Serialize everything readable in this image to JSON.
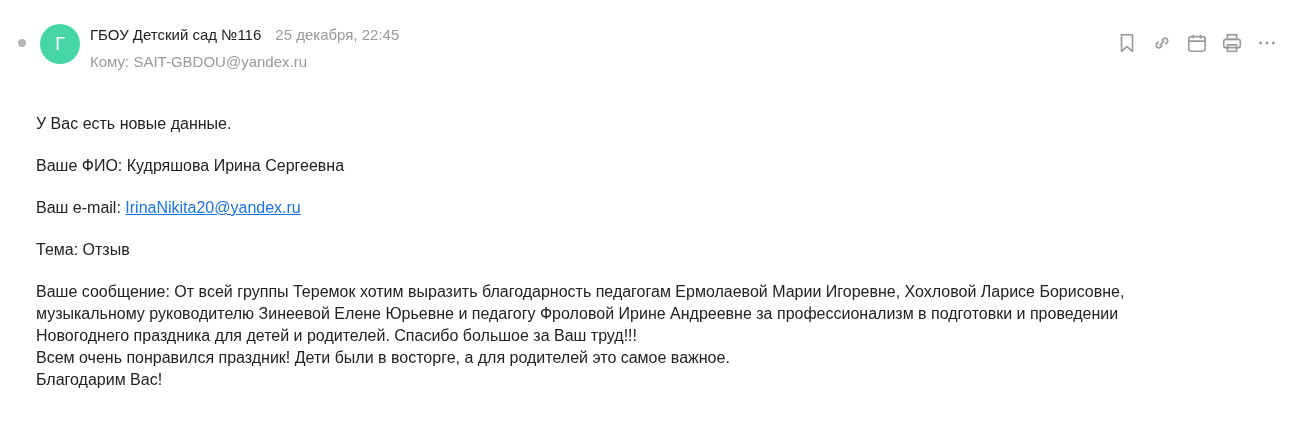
{
  "header": {
    "avatar_letter": "Г",
    "sender": "ГБОУ Детский сад №116",
    "date": "25 декабря, 22:45",
    "to": "Кому: SAIT-GBDOU@yandex.ru"
  },
  "body": [
    {
      "kind": "text",
      "text": "У Вас есть новые данные."
    },
    {
      "kind": "text",
      "text": "Ваше ФИО: Кудряшова Ирина Сергеевна"
    },
    {
      "kind": "link",
      "text": "Ваш e-mail: ",
      "link": "IrinaNikita20@yandex.ru"
    },
    {
      "kind": "text",
      "text": "Тема: Отзыв"
    },
    {
      "kind": "lines",
      "lines": [
        "Ваше сообщение: От всей группы Теремок хотим выразить благодарность педагогам Ермолаевой Марии Игоревне, Хохловой Ларисе Борисовне, музыкальному руководителю Зинеевой Елене Юрьевне и педагогу Фроловой Ирине Андреевне за профессионализм в подготовки и проведении Новогоднего праздника для детей и родителей. Спасибо большое за Ваш труд!!!",
        "Всем очень понравился праздник! Дети были в восторге, а для родителей это самое важное.",
        "Благодарим Вас!"
      ]
    }
  ]
}
